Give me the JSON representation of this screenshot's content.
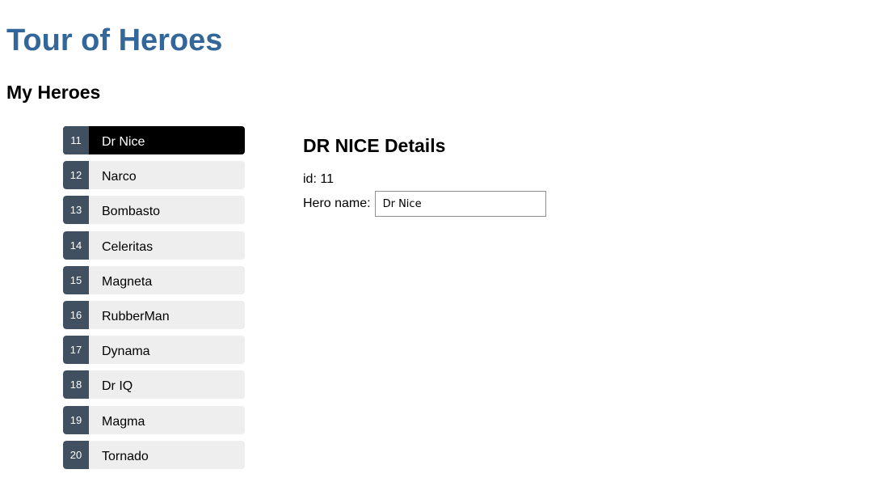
{
  "app": {
    "title": "Tour of Heroes"
  },
  "heroes_section": {
    "title": "My Heroes",
    "selected_id": "11",
    "items": [
      {
        "id": "11",
        "name": "Dr Nice"
      },
      {
        "id": "12",
        "name": "Narco"
      },
      {
        "id": "13",
        "name": "Bombasto"
      },
      {
        "id": "14",
        "name": "Celeritas"
      },
      {
        "id": "15",
        "name": "Magneta"
      },
      {
        "id": "16",
        "name": "RubberMan"
      },
      {
        "id": "17",
        "name": "Dynama"
      },
      {
        "id": "18",
        "name": "Dr IQ"
      },
      {
        "id": "19",
        "name": "Magma"
      },
      {
        "id": "20",
        "name": "Tornado"
      }
    ]
  },
  "details": {
    "title": "DR NICE Details",
    "id_label": "id:",
    "id_value": "11",
    "name_label": "Hero name:",
    "name_value": "Dr Nice",
    "name_placeholder": "name"
  },
  "colors": {
    "title": "#336699",
    "badge": "#405061",
    "item_bg": "#eeeeee",
    "selected_bg": "#000000"
  }
}
